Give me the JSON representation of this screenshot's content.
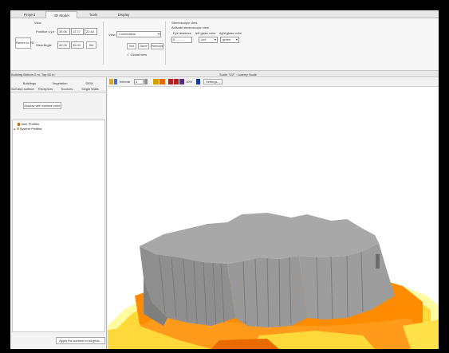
{
  "tabs": [
    {
      "label": "Project"
    },
    {
      "label": "3D Model"
    },
    {
      "label": "Tools"
    },
    {
      "label": "Display"
    }
  ],
  "ribbon": {
    "view_group_label": "View",
    "return_button": "Return to 2D",
    "position_label": "Position x,y,z",
    "position_values": [
      "35.06",
      "12.77",
      "22.63"
    ],
    "view_angle_label": "View Angle",
    "view_angle_values": [
      "49.00",
      "35.00"
    ],
    "set_button": "Set",
    "view_label": "View",
    "view_select": "Contextless",
    "set2_button": "Set",
    "store_button": "Store",
    "remove_button": "Remove",
    "global_view_check": "✓ Global view",
    "stereo_group_label": "Stereoscopic view",
    "stereo_activate": "Activate stereoscopic view",
    "eye_distance_label": "Eye distance",
    "left_glass_label": "left glass color",
    "right_glass_label": "right glass color",
    "eye_distance_value": "0...........",
    "left_glass_value": "red",
    "right_glass_value": "green"
  },
  "statusbar": {
    "left_text": "Building Bottom 0 m, Top 60 m",
    "center_text": "Scale \"1/2\" : Lowery Scale"
  },
  "leftpanel": {
    "tabs_row1": [
      "Buildings",
      "Vegetation",
      "DEM"
    ],
    "tabs_row2": [
      "Soil and surface",
      "Receptors",
      "Sources",
      "Single Walls"
    ],
    "display_button": "Display with surface color",
    "tree": {
      "user_profiles": "User Profiles",
      "system_profiles": "System Profiles"
    },
    "apply_button": "Apply the surface to all grids..."
  },
  "vtoolbar": {
    "interval_label": "Interval",
    "interval_value": "3",
    "ip_label": "10%",
    "settings_button": "Settings..."
  },
  "colors": {
    "orange": "#ff8c00",
    "dark_orange": "#e86a00",
    "yellow": "#ffd83a",
    "pale_yellow": "#fffba0",
    "building_top": "#a8a8a8",
    "building_side": "#8f8f8f"
  }
}
